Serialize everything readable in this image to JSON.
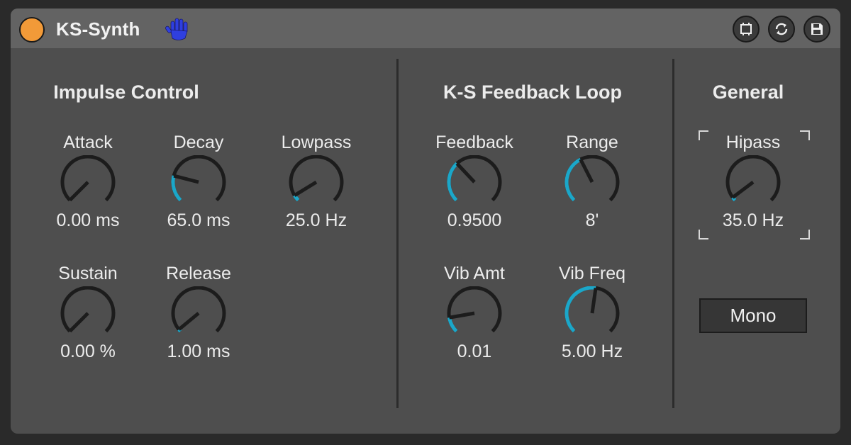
{
  "device": {
    "title": "KS-Synth",
    "icons": [
      "power-icon",
      "hand-icon",
      "map-icon",
      "replace-icon",
      "save-icon"
    ],
    "colors": {
      "background": "#4e4e4e",
      "titlebar": "#636363",
      "power": "#f29a38",
      "accent": "#1ba7c9",
      "hand": "#2f3fe0"
    }
  },
  "sections": {
    "impulse": {
      "title": "Impulse Control",
      "attack": {
        "label": "Attack",
        "value": "0.00 ms",
        "level": 0.0
      },
      "decay": {
        "label": "Decay",
        "value": "65.0 ms",
        "level": 0.22
      },
      "lowpass": {
        "label": "Lowpass",
        "value": "25.0 Hz",
        "level": 0.05
      },
      "sustain": {
        "label": "Sustain",
        "value": "0.00 %",
        "level": 0.0
      },
      "release": {
        "label": "Release",
        "value": "1.00 ms",
        "level": 0.02
      }
    },
    "feedback": {
      "title": "K-S Feedback Loop",
      "feedback": {
        "label": "Feedback",
        "value": "0.9500",
        "level": 0.34
      },
      "range": {
        "label": "Range",
        "value": "8'",
        "level": 0.4
      },
      "vibamt": {
        "label": "Vib Amt",
        "value": "0.01",
        "level": 0.13
      },
      "vibfreq": {
        "label": "Vib Freq",
        "value": "5.00 Hz",
        "level": 0.53
      }
    },
    "general": {
      "title": "General",
      "hipass": {
        "label": "Hipass",
        "value": "35.0 Hz",
        "level": 0.03
      },
      "mono_label": "Mono"
    }
  }
}
